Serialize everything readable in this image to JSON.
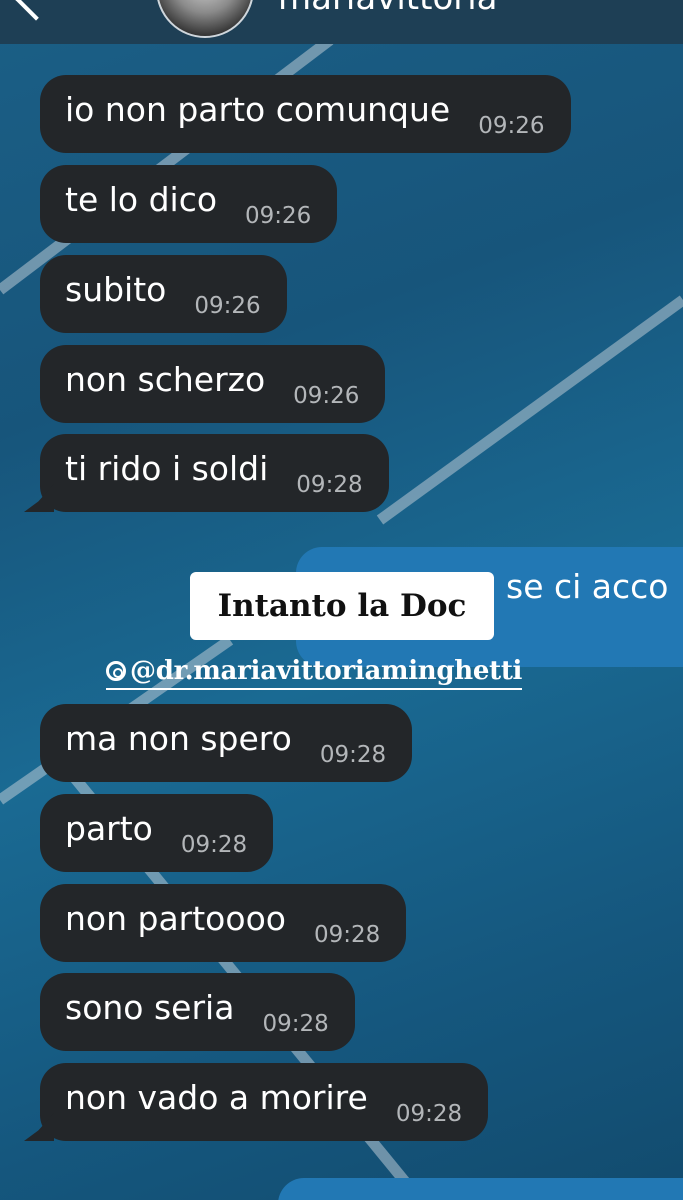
{
  "header": {
    "contact_name": "mariavittoria",
    "icons": {
      "back": "back-arrow-icon",
      "avatar": "contact-avatar"
    }
  },
  "messages_before": [
    {
      "text": "io non parto comunque",
      "time": "09:26"
    },
    {
      "text": "te lo dico",
      "time": "09:26"
    },
    {
      "text": "subito",
      "time": "09:26"
    },
    {
      "text": "non scherzo",
      "time": "09:26"
    },
    {
      "text": "ti rido i soldi",
      "time": "09:28"
    }
  ],
  "outgoing_message": {
    "visible_text": "se ci acco"
  },
  "overlay": {
    "sticker_text": "Intanto la Doc",
    "mention": "@dr.mariavittoriaminghetti"
  },
  "messages_after": [
    {
      "text": "ma non spero",
      "time": "09:28"
    },
    {
      "text": "parto",
      "time": "09:28"
    },
    {
      "text": "non partoooo",
      "time": "09:28"
    },
    {
      "text": "sono seria",
      "time": "09:28"
    },
    {
      "text": "non vado a morire",
      "time": "09:28"
    }
  ],
  "colors": {
    "incoming_bubble": "#232629",
    "outgoing_bubble": "#2278b4",
    "timestamp": "#b3b6b9",
    "background": "#1b5f86"
  }
}
